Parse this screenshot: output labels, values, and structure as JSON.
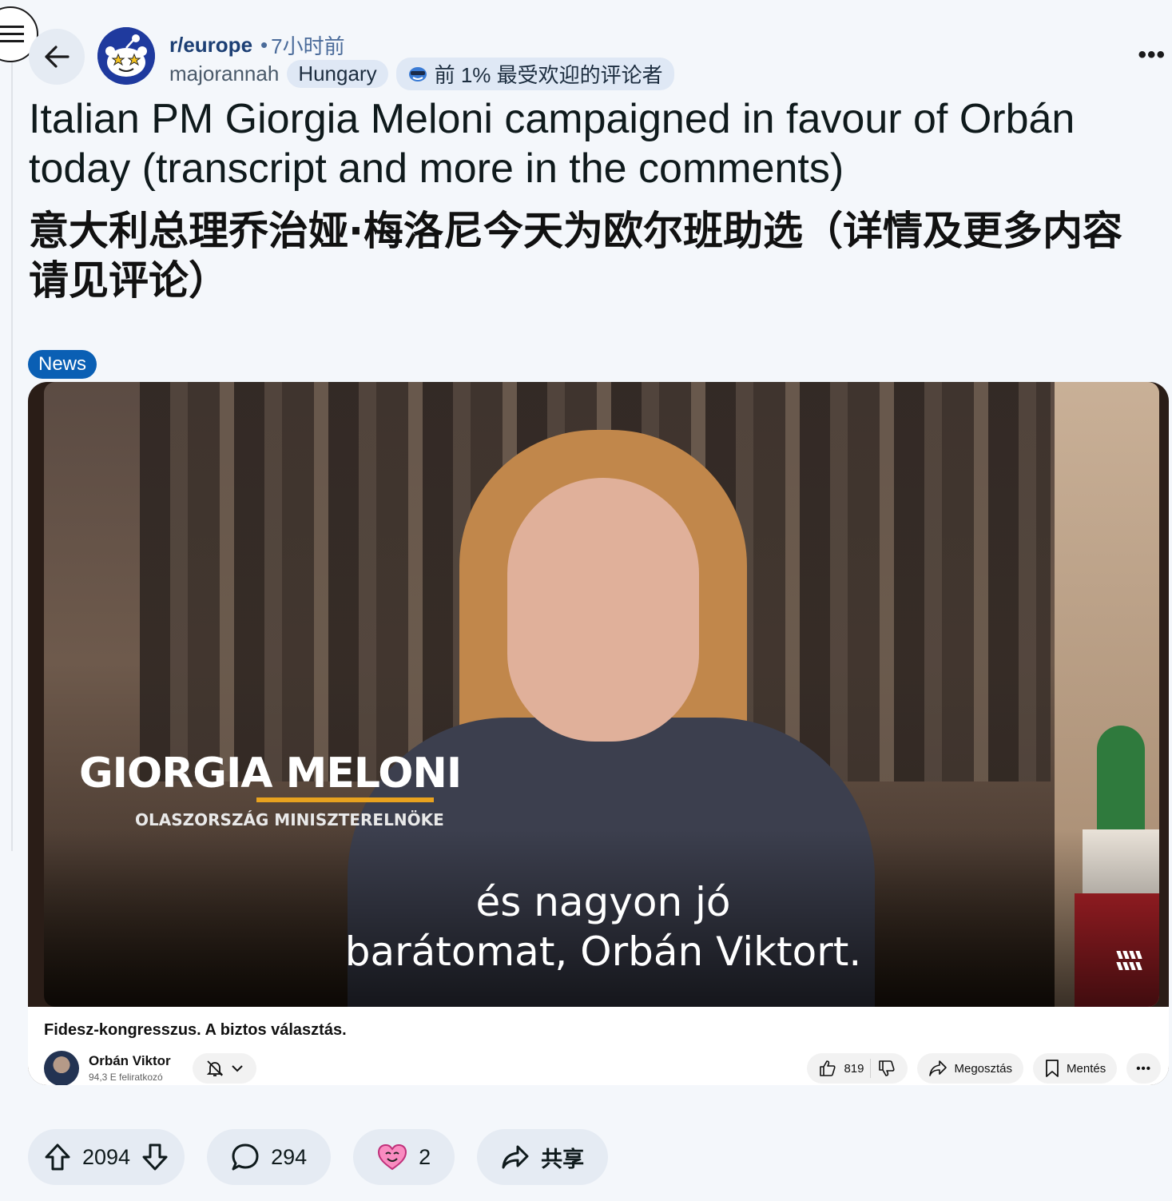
{
  "header": {
    "subreddit": "r/europe",
    "time_ago": "7小时前",
    "username": "majorannah",
    "user_flair": "Hungary",
    "achievement_badge": "前 1% 最受欢迎的评论者",
    "icons": {
      "menu": "hamburger-icon",
      "back": "arrow-left-icon",
      "more": "ellipsis-icon"
    }
  },
  "post": {
    "title_en": "Italian PM Giorgia Meloni campaigned in favour of Orbán today (transcript and more in the comments)",
    "title_zh": "意大利总理乔治娅·梅洛尼今天为欧尔班助选（详情及更多内容请见评论）",
    "flair": "News",
    "flair_color": "#0a5fb4"
  },
  "video": {
    "lower_third_name": "GIORGIA MELONI",
    "lower_third_role": "OLASZORSZÁG MINISZTERELNÖKE",
    "subtitle_line1": "és nagyon jó",
    "subtitle_line2": "barátomat, Orbán Viktort.",
    "yt_title": "Fidesz-kongresszus. A biztos választás.",
    "channel_name": "Orbán Viktor",
    "channel_subs": "94,3 E feliratkozó",
    "like_count": "819",
    "share_label": "Megosztás",
    "save_label": "Mentés"
  },
  "actions": {
    "vote_count": "2094",
    "comment_count": "294",
    "award_count": "2",
    "share_label": "共享"
  },
  "colors": {
    "background": "#f4f7fb",
    "pill_bg": "#e5ebf3",
    "accent_blue": "#0a5fb4",
    "lower_third_bar": "#e8a21f"
  }
}
